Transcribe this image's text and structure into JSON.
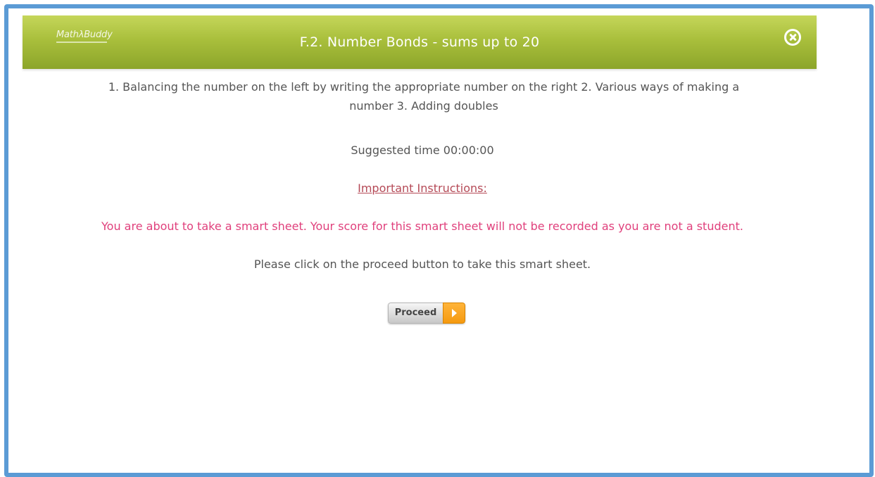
{
  "header": {
    "logo_text": "MathλBuddy",
    "title": "F.2. Number Bonds - sums up to 20",
    "close_icon": "close-circle-icon"
  },
  "content": {
    "description": "1. Balancing the number on the left by writing the appropriate number on the right 2. Various ways of making a number 3. Adding doubles",
    "suggested_time": "Suggested time 00:00:00",
    "important_heading": "Important Instructions:",
    "warning": "You are about to take a smart sheet. Your score for this smart sheet will not be recorded as you are not a student.",
    "click_instruction": "Please click on the proceed button to take this smart sheet.",
    "proceed_label": "Proceed",
    "proceed_icon": "arrow-right-icon"
  },
  "colors": {
    "header_green": "#a9bf3c",
    "frame_blue": "#5b9bd5",
    "warning_pink": "#e0407c",
    "heading_red": "#b54a57",
    "proceed_orange": "#f59a10"
  }
}
